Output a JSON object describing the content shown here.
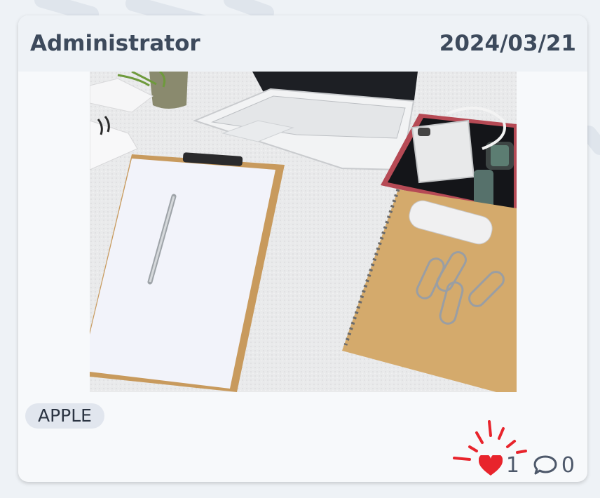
{
  "post": {
    "author": "Administrator",
    "date": "2024/03/21",
    "tag": "APPLE",
    "likes": "1",
    "comments": "0"
  },
  "image": {
    "subject": "desk-with-clipboard-laptop-tablet-notebook"
  },
  "icons": {
    "like": "heart-icon",
    "comment": "comment-icon",
    "burst": "like-burst-icon"
  },
  "colors": {
    "like_red": "#e8242c",
    "text": "#3d4a5c",
    "tag_bg": "#e1e6ee"
  }
}
